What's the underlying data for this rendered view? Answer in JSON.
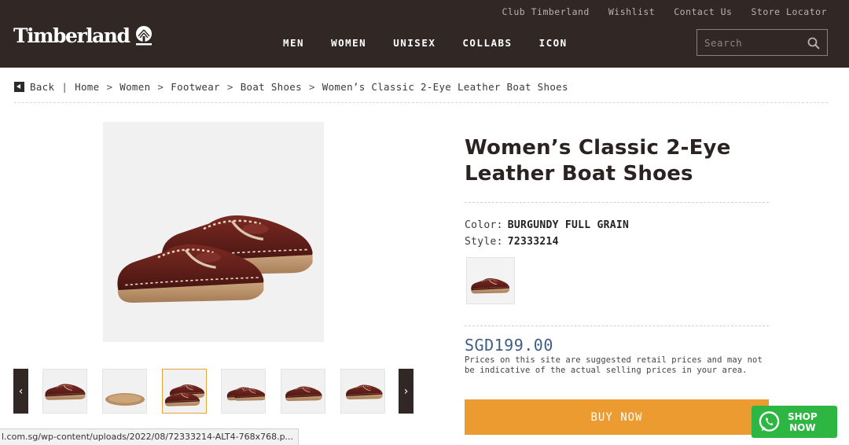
{
  "header": {
    "top_links": [
      "Club Timberland",
      "Wishlist",
      "Contact Us",
      "Store Locator"
    ],
    "logo_text": "Timberland",
    "nav": [
      "MEN",
      "WOMEN",
      "UNISEX",
      "COLLABS",
      "ICON"
    ],
    "search_placeholder": "Search"
  },
  "breadcrumb": {
    "back": "Back",
    "separator": "|",
    "arrow": ">",
    "items": [
      "Home",
      "Women",
      "Footwear",
      "Boat Shoes",
      "Women’s Classic 2-Eye Leather Boat Shoes"
    ]
  },
  "gallery": {
    "prev_arrow": "‹",
    "next_arrow": "›",
    "thumbnail_count": 6,
    "active_thumbnail": 3
  },
  "product": {
    "title_line1": "Women’s Classic 2-Eye",
    "title_line2": "Leather Boat Shoes",
    "color_label": "Color:",
    "color_value": "BURGUNDY FULL GRAIN",
    "style_label": "Style:",
    "style_value": "72333214",
    "price": "SGD199.00",
    "disclaimer": "Prices on this site are suggested retail prices and may not be indicative of the actual selling prices in your area.",
    "buy_label": "BUY NOW"
  },
  "whatsapp": {
    "line1": "SHOP",
    "line2": "NOW"
  },
  "status_bar": "l.com.sg/wp-content/uploads/2022/08/72333214-ALT4-768x768.p...",
  "colors": {
    "header_bg": "#312826",
    "buy_button": "#eb9b2f",
    "price": "#3f5e82",
    "whatsapp": "#2db742",
    "active_thumb_border": "#e6a43a"
  },
  "icons": [
    "tree-logo-icon",
    "search-icon",
    "back-arrow-icon",
    "chevron-left-icon",
    "chevron-right-icon",
    "whatsapp-icon"
  ]
}
